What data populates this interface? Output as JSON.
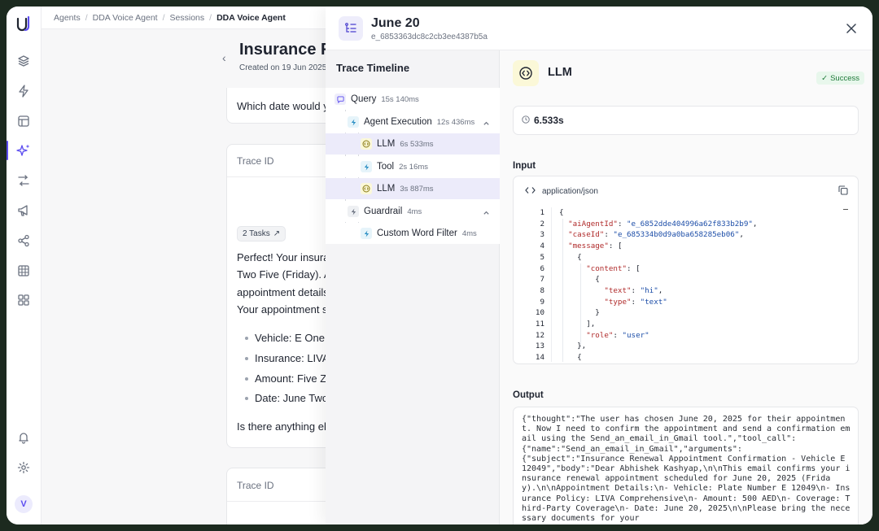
{
  "breadcrumb": [
    "Agents",
    "DDA Voice Agent",
    "Sessions",
    "DDA Voice Agent"
  ],
  "page": {
    "title": "Insurance Re",
    "created": "Created on 19 Jun 2025,",
    "question_partial": "Which date would y",
    "trace_id_label": "Trace ID",
    "tasks_chip": "2 Tasks",
    "reply_lines": [
      "Perfect! Your insura",
      "Two Five (Friday). A",
      "appointment details",
      "Your appointment s"
    ],
    "bullets": [
      "Vehicle: E One T",
      "Insurance: LIVA",
      "Amount: Five Ze",
      "Date: June Two"
    ],
    "closing_partial": "Is there anything el",
    "trace_id_label_2": "Trace ID"
  },
  "drawer": {
    "title": "June 20",
    "subtitle": "e_6853363dc8c2cb3ee4387b5a",
    "timeline_title": "Trace Timeline",
    "timeline": [
      {
        "label": "Query",
        "duration": "15s 140ms",
        "icon": "chat-icon"
      },
      {
        "label": "Agent Execution",
        "duration": "12s 436ms",
        "icon": "bolt-icon"
      },
      {
        "label": "LLM",
        "duration": "6s 533ms",
        "icon": "code-circle-icon"
      },
      {
        "label": "Tool",
        "duration": "2s 16ms",
        "icon": "bolt-icon"
      },
      {
        "label": "LLM",
        "duration": "3s 887ms",
        "icon": "code-circle-icon"
      },
      {
        "label": "Guardrail",
        "duration": "4ms",
        "icon": "bolt-icon"
      },
      {
        "label": "Custom Word Filter",
        "duration": "4ms",
        "icon": "bolt-icon"
      }
    ],
    "detail": {
      "title": "LLM",
      "status": "Success",
      "duration": "6.533s",
      "input_label": "Input",
      "content_type": "application/json",
      "line_numbers": [
        "1",
        "2",
        "3",
        "4",
        "5",
        "6",
        "7",
        "8",
        "9",
        "10",
        "11",
        "12",
        "13",
        "14"
      ],
      "code": {
        "aiAgentId_key": "\"aiAgentId\"",
        "aiAgentId_val": "\"e_6852dde404996a62f833b2b9\"",
        "caseId_key": "\"caseId\"",
        "caseId_val": "\"e_685334b0d9a0ba658285eb06\"",
        "message_key": "\"message\"",
        "content_key": "\"content\"",
        "text_key": "\"text\"",
        "text_val": "\"hi\"",
        "type_key": "\"type\"",
        "type_val": "\"text\"",
        "role_key": "\"role\"",
        "role_val": "\"user\""
      },
      "output_label": "Output",
      "output_text": "{\"thought\":\"The user has chosen June 20, 2025 for their appointment. Now I need to confirm the appointment and send a confirmation email using the Send_an_email_in_Gmail tool.\",\"tool_call\":\n{\"name\":\"Send_an_email_in_Gmail\",\"arguments\":\n{\"subject\":\"Insurance Renewal Appointment Confirmation - Vehicle E 12049\",\"body\":\"Dear Abhishek Kashyap,\\n\\nThis email confirms your insurance renewal appointment scheduled for June 20, 2025 (Friday).\\n\\nAppointment Details:\\n- Vehicle: Plate Number E 12049\\n- Insurance Policy: LIVA Comprehensive\\n- Amount: 500 AED\\n- Coverage: Third-Party Coverage\\n- Date: June 20, 2025\\n\\nPlease bring the necessary documents for your"
    }
  },
  "rail": {
    "avatar_initial": "V"
  },
  "colors": {
    "accent": "#5b4cf0",
    "success": "#1f7a3a",
    "llm_icon_bg": "#fbf8d8"
  }
}
